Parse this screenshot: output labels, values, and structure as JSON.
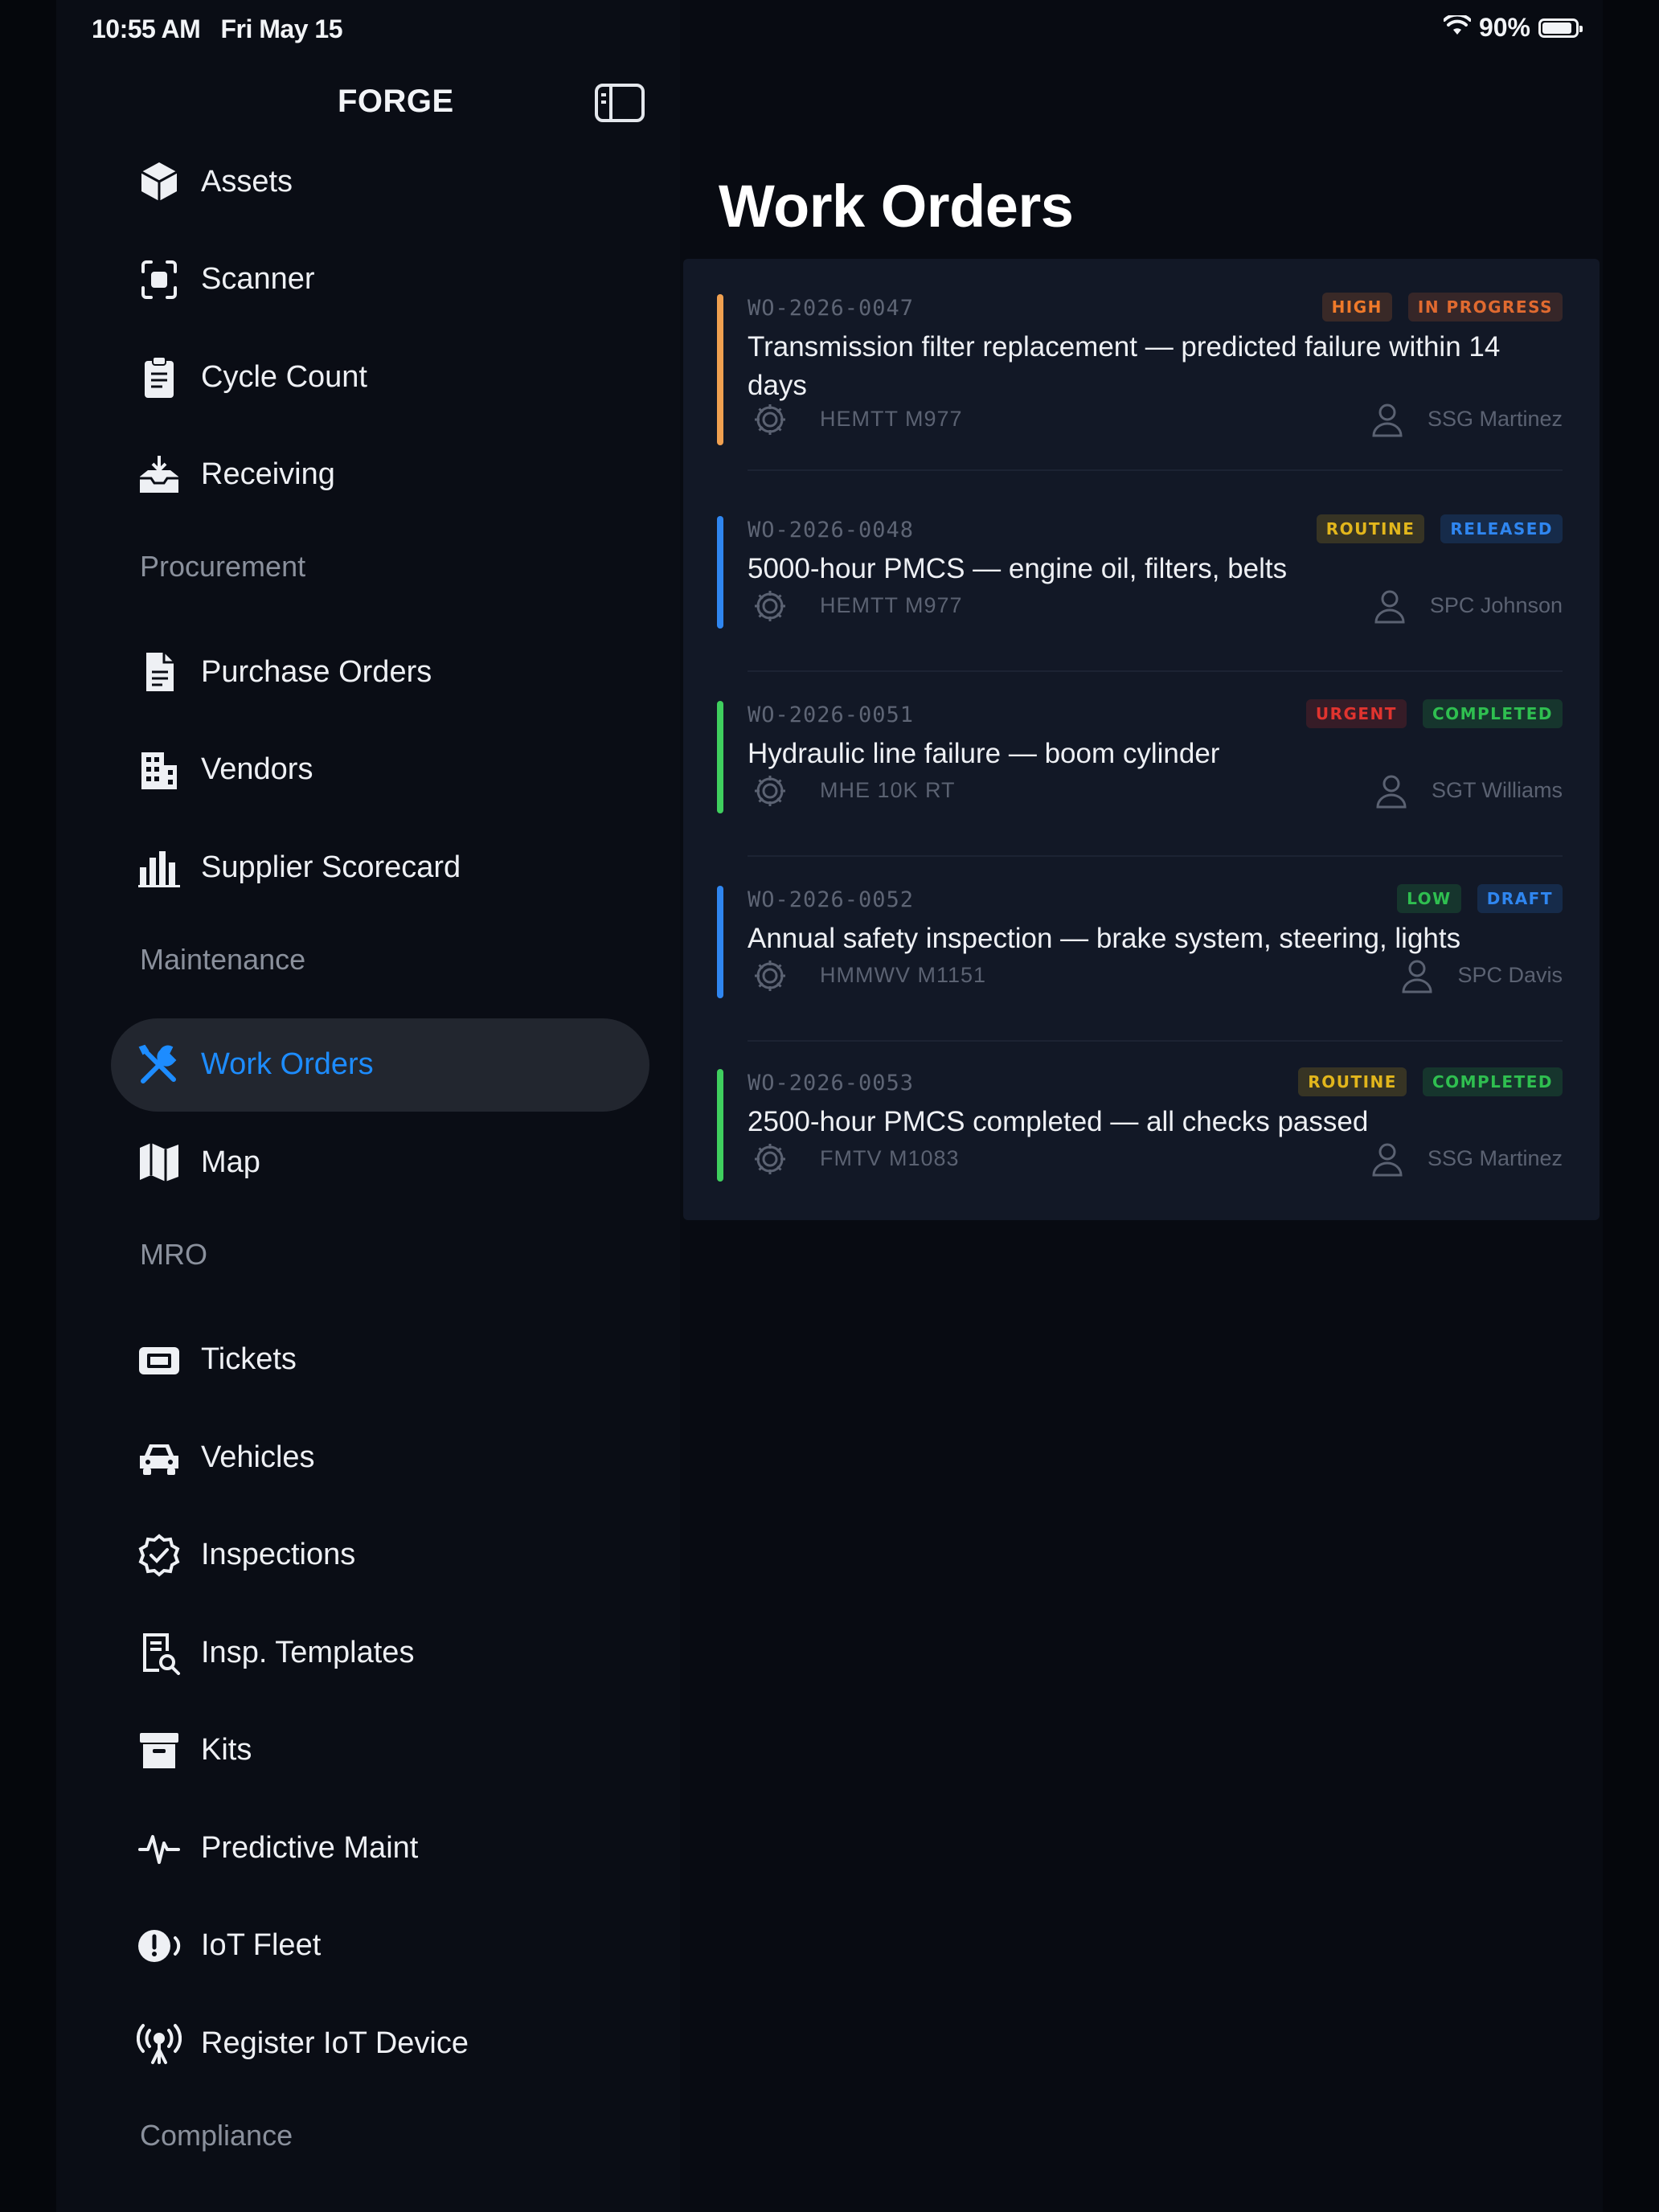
{
  "status_bar": {
    "time": "10:55 AM",
    "date": "Fri May 15",
    "battery": "90%",
    "battery_level": 0.9,
    "wifi_icon": "wifi-icon",
    "battery_icon": "battery-icon"
  },
  "sidebar": {
    "brand": "FORGE",
    "toggle_icon": "sidebar-toggle-icon",
    "sections": [
      {
        "label": "",
        "items": [
          {
            "label": "Assets",
            "icon": "cube-icon"
          },
          {
            "label": "Scanner",
            "icon": "scanner-icon"
          },
          {
            "label": "Cycle Count",
            "icon": "clipboard-icon"
          },
          {
            "label": "Receiving",
            "icon": "inbox-tray-icon"
          }
        ]
      },
      {
        "label": "Procurement",
        "items": [
          {
            "label": "Purchase Orders",
            "icon": "document-icon"
          },
          {
            "label": "Vendors",
            "icon": "building-icon"
          },
          {
            "label": "Supplier Scorecard",
            "icon": "bar-chart-icon"
          }
        ]
      },
      {
        "label": "Maintenance",
        "items": [
          {
            "label": "Work Orders",
            "icon": "wrench-screwdriver-icon",
            "active": true
          },
          {
            "label": "Map",
            "icon": "map-icon"
          }
        ]
      },
      {
        "label": "MRO",
        "items": [
          {
            "label": "Tickets",
            "icon": "ticket-icon"
          },
          {
            "label": "Vehicles",
            "icon": "car-icon"
          },
          {
            "label": "Inspections",
            "icon": "checkmark-seal-icon"
          },
          {
            "label": "Insp. Templates",
            "icon": "document-magnifier-icon"
          },
          {
            "label": "Kits",
            "icon": "archive-box-icon"
          },
          {
            "label": "Predictive Maint",
            "icon": "waveform-icon"
          },
          {
            "label": "IoT Fleet",
            "icon": "sensor-icon"
          },
          {
            "label": "Register IoT Device",
            "icon": "antenna-icon"
          }
        ]
      },
      {
        "label": "Compliance",
        "items": []
      }
    ]
  },
  "main": {
    "title": "Work Orders",
    "work_orders": [
      {
        "id": "WO-2026-0047",
        "title": "Transmission filter replacement — predicted failure within 14 days",
        "priority": "HIGH",
        "status": "IN PROGRESS",
        "asset": "HEMTT M977",
        "assignee": "SSG Martinez",
        "accent_color": "#f0a050",
        "priority_color": "#f07a2a",
        "status_color": "#e06a30"
      },
      {
        "id": "WO-2026-0048",
        "title": "5000-hour PMCS — engine oil, filters, belts",
        "priority": "ROUTINE",
        "status": "RELEASED",
        "asset": "HEMTT M977",
        "assignee": "SPC Johnson",
        "accent_color": "#2f86f0",
        "priority_color": "#e2b61c",
        "status_color": "#2f86f0"
      },
      {
        "id": "WO-2026-0051",
        "title": "Hydraulic line failure — boom cylinder",
        "priority": "URGENT",
        "status": "COMPLETED",
        "asset": "MHE 10K RT",
        "assignee": "SGT Williams",
        "accent_color": "#3fcf5e",
        "priority_color": "#e0342f",
        "status_color": "#2fbf50"
      },
      {
        "id": "WO-2026-0052",
        "title": "Annual safety inspection — brake system, steering, lights",
        "priority": "LOW",
        "status": "DRAFT",
        "asset": "HMMWV M1151",
        "assignee": "SPC Davis",
        "accent_color": "#2f86f0",
        "priority_color": "#2fbf50",
        "status_color": "#2f86f0"
      },
      {
        "id": "WO-2026-0053",
        "title": "2500-hour PMCS completed — all checks passed",
        "priority": "ROUTINE",
        "status": "COMPLETED",
        "asset": "FMTV M1083",
        "assignee": "SSG Martinez",
        "accent_color": "#3fcf5e",
        "priority_color": "#e2b61c",
        "status_color": "#2fbf50"
      }
    ]
  }
}
